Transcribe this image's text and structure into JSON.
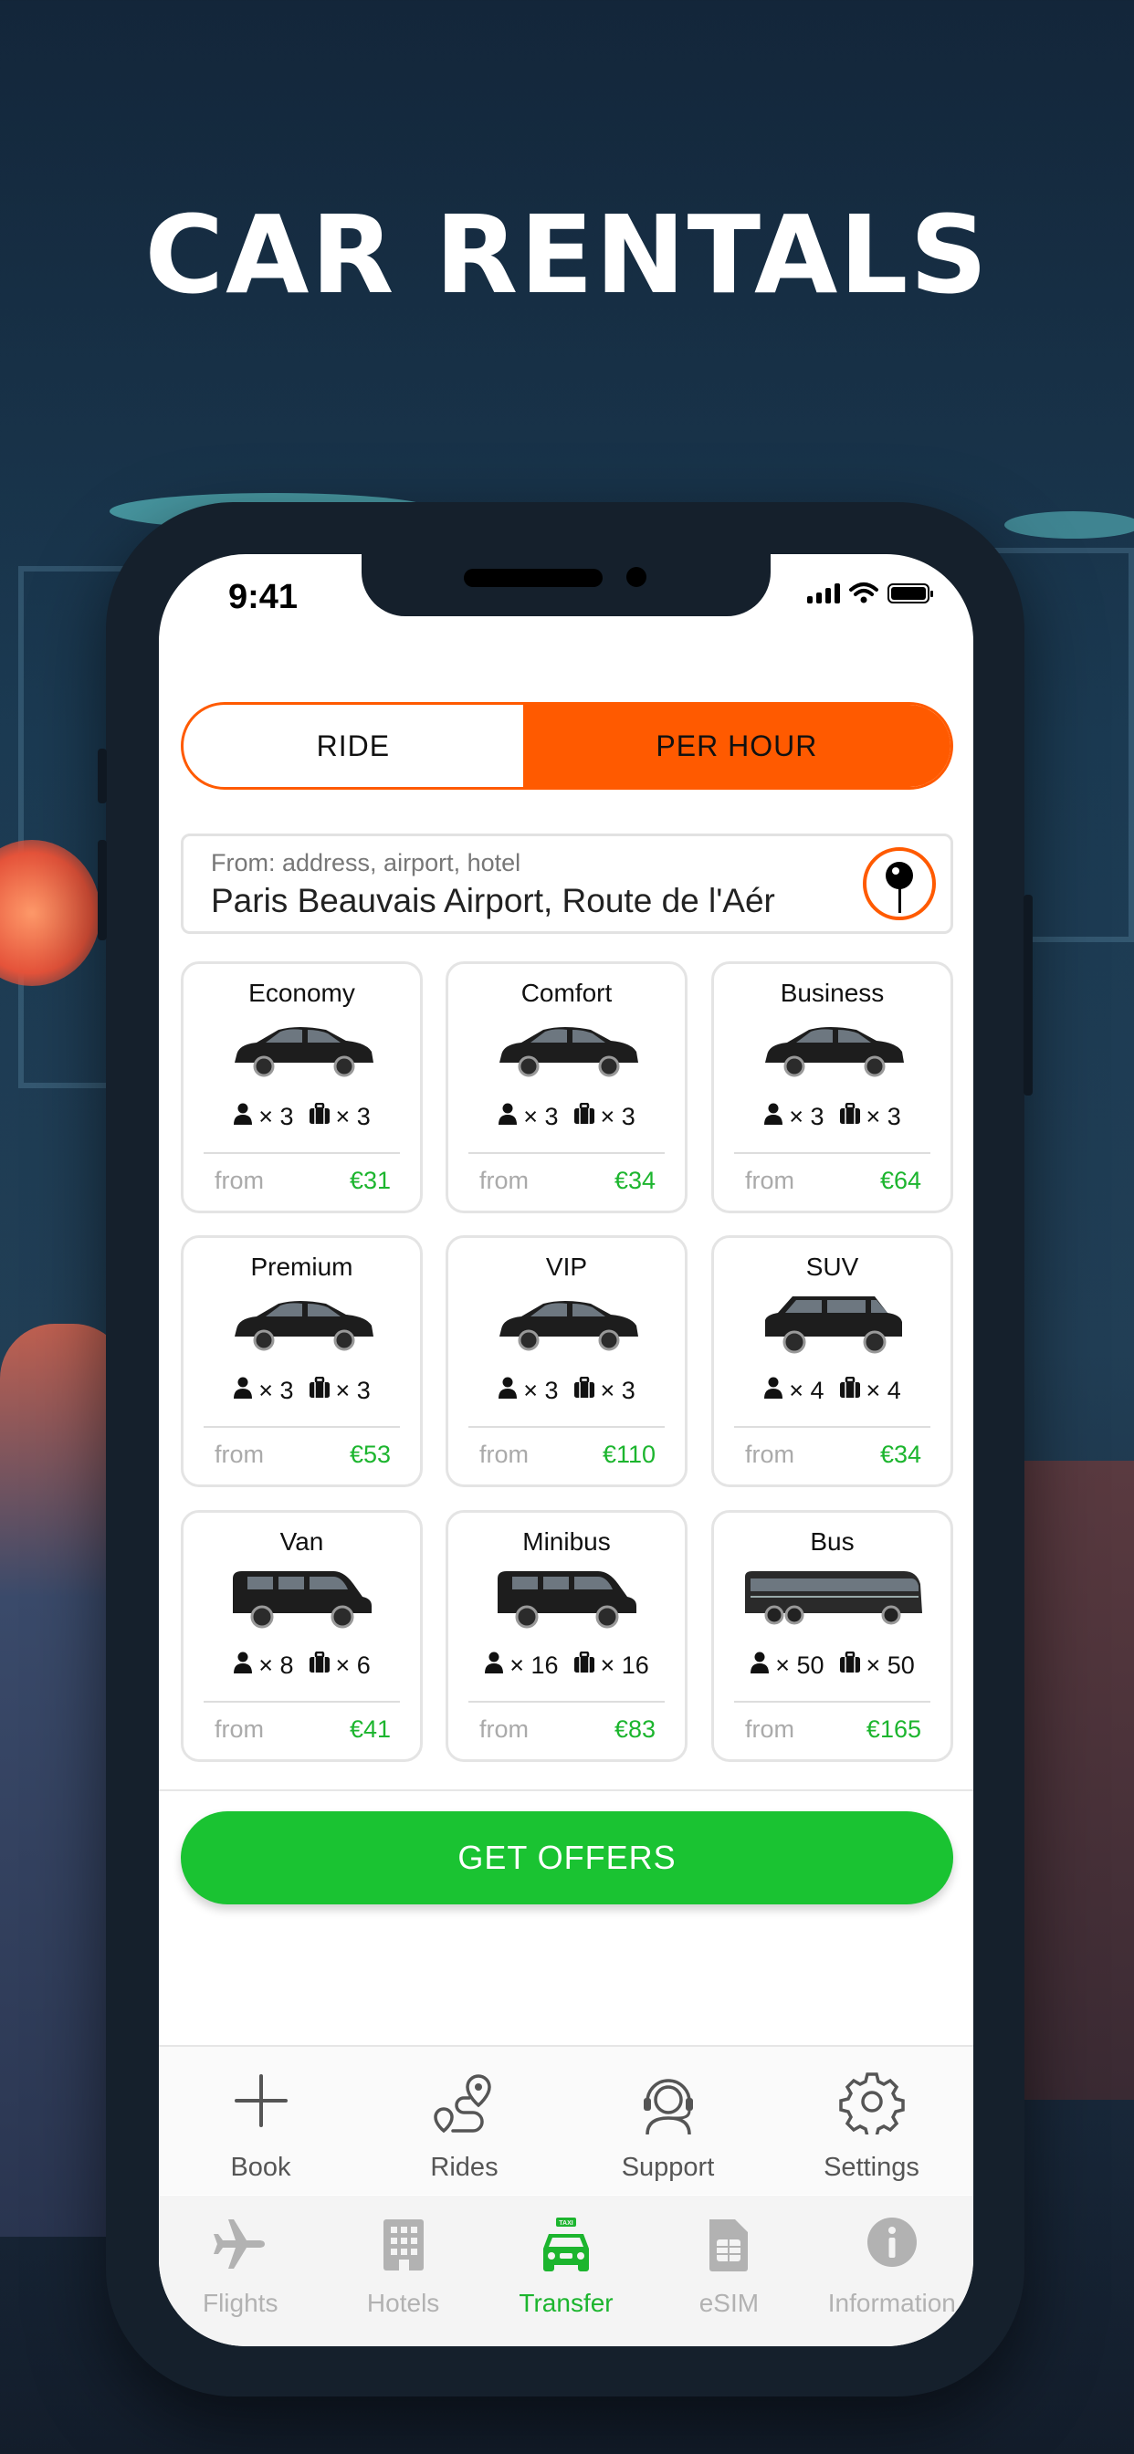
{
  "headline": "CAR RENTALS",
  "status_bar": {
    "time": "9:41"
  },
  "mode_toggle": {
    "ride_label": "RIDE",
    "per_hour_label": "PER HOUR",
    "selected": "PER HOUR"
  },
  "from_field": {
    "label": "From: address, airport, hotel",
    "value": "Paris Beauvais Airport, Route de l'Aér"
  },
  "cars": [
    {
      "name": "Economy",
      "passengers": "× 3",
      "luggage": "× 3",
      "from_label": "from",
      "price": "€31"
    },
    {
      "name": "Comfort",
      "passengers": "× 3",
      "luggage": "× 3",
      "from_label": "from",
      "price": "€34"
    },
    {
      "name": "Business",
      "passengers": "× 3",
      "luggage": "× 3",
      "from_label": "from",
      "price": "€64"
    },
    {
      "name": "Premium",
      "passengers": "× 3",
      "luggage": "× 3",
      "from_label": "from",
      "price": "€53"
    },
    {
      "name": "VIP",
      "passengers": "× 3",
      "luggage": "× 3",
      "from_label": "from",
      "price": "€110"
    },
    {
      "name": "SUV",
      "passengers": "× 4",
      "luggage": "× 4",
      "from_label": "from",
      "price": "€34"
    },
    {
      "name": "Van",
      "passengers": "× 8",
      "luggage": "× 6",
      "from_label": "from",
      "price": "€41"
    },
    {
      "name": "Minibus",
      "passengers": "× 16",
      "luggage": "× 16",
      "from_label": "from",
      "price": "€83"
    },
    {
      "name": "Bus",
      "passengers": "× 50",
      "luggage": "× 50",
      "from_label": "from",
      "price": "€165"
    }
  ],
  "get_offers_label": "GET OFFERS",
  "quick_actions": [
    {
      "label": "Book",
      "icon": "plus-icon"
    },
    {
      "label": "Rides",
      "icon": "route-icon"
    },
    {
      "label": "Support",
      "icon": "headset-icon"
    },
    {
      "label": "Settings",
      "icon": "gear-icon"
    }
  ],
  "tabs": [
    {
      "label": "Flights",
      "icon": "airplane-icon",
      "active": false
    },
    {
      "label": "Hotels",
      "icon": "building-icon",
      "active": false
    },
    {
      "label": "Transfer",
      "icon": "taxi-icon",
      "active": true
    },
    {
      "label": "eSIM",
      "icon": "sim-card-icon",
      "active": false
    },
    {
      "label": "Information",
      "icon": "info-icon",
      "active": false
    }
  ],
  "colors": {
    "accent_orange": "#ff5a00",
    "accent_green": "#1ac332",
    "price_green": "#1cb52e"
  }
}
